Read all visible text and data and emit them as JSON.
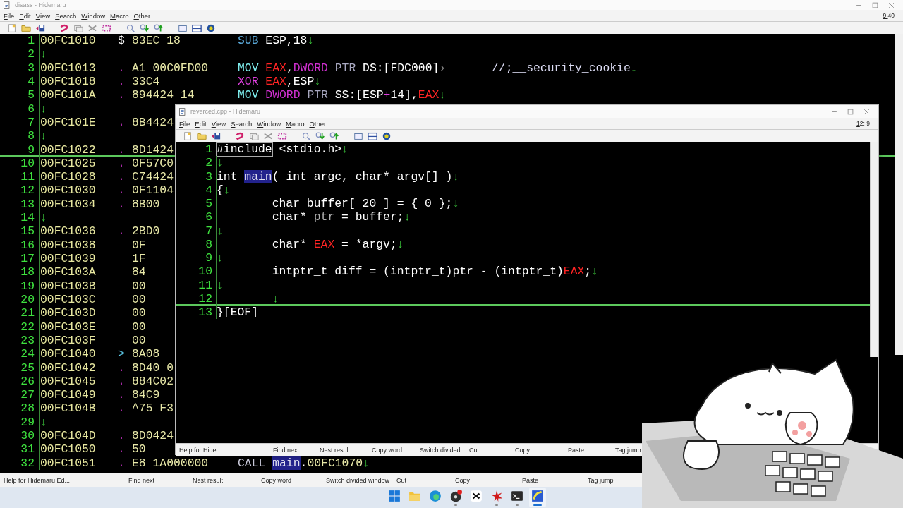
{
  "back_window": {
    "kind": "disassembly",
    "title": "disass - Hidemaru",
    "menu": [
      "File",
      "Edit",
      "View",
      "Search",
      "Window",
      "Macro",
      "Other"
    ],
    "position": "9:40",
    "lines": [
      {
        "number": "1",
        "current": false,
        "address": "00FC1010",
        "marker": {
          "text": "$",
          "kind": "plain"
        },
        "hex": "83EC 18",
        "code": [
          {
            "text": "SUB",
            "kind": "arith"
          },
          {
            "text": " ESP,18",
            "kind": "plain"
          },
          {
            "text": "↓",
            "kind": "eol"
          }
        ]
      },
      {
        "number": "2",
        "current": false,
        "code": [
          {
            "text": "↓",
            "kind": "eol"
          }
        ]
      },
      {
        "number": "3",
        "current": false,
        "address": "00FC1013",
        "marker": {
          "text": ".",
          "kind": "dot"
        },
        "hex": "A1 00C0FD00",
        "code": [
          {
            "text": "MOV ",
            "kind": "move"
          },
          {
            "text": "EAX",
            "kind": "register"
          },
          {
            "text": ",",
            "kind": "plain"
          },
          {
            "text": "DWORD",
            "kind": "size"
          },
          {
            "text": " PTR",
            "kind": "keyword"
          },
          {
            "text": " DS:[FDC000]",
            "kind": "plain"
          },
          {
            "text": "›",
            "kind": "wrap"
          }
        ],
        "comment": [
          {
            "text": "//;__security_cookie",
            "kind": "comment"
          },
          {
            "text": "↓",
            "kind": "eol"
          }
        ]
      },
      {
        "number": "4",
        "current": false,
        "address": "00FC1018",
        "marker": {
          "text": ".",
          "kind": "dot"
        },
        "hex": "33C4",
        "code": [
          {
            "text": "XOR ",
            "kind": "logic"
          },
          {
            "text": "EAX",
            "kind": "register"
          },
          {
            "text": ",ESP",
            "kind": "plain"
          },
          {
            "text": "↓",
            "kind": "eol"
          }
        ]
      },
      {
        "number": "5",
        "current": false,
        "address": "00FC101A",
        "marker": {
          "text": ".",
          "kind": "dot"
        },
        "hex": "894424 14",
        "code": [
          {
            "text": "MOV ",
            "kind": "move"
          },
          {
            "text": "DWORD",
            "kind": "size"
          },
          {
            "text": " PTR",
            "kind": "keyword"
          },
          {
            "text": " SS:[ESP",
            "kind": "plain"
          },
          {
            "text": "+",
            "kind": "operator"
          },
          {
            "text": "14],",
            "kind": "plain"
          },
          {
            "text": "EAX",
            "kind": "register"
          },
          {
            "text": "↓",
            "kind": "eol"
          }
        ]
      },
      {
        "number": "6",
        "current": false,
        "code": [
          {
            "text": "↓",
            "kind": "eol"
          }
        ]
      },
      {
        "number": "7",
        "current": false,
        "address": "00FC101E",
        "marker": {
          "text": ".",
          "kind": "dot"
        },
        "hex": "8B4424"
      },
      {
        "number": "8",
        "current": false,
        "code": [
          {
            "text": "↓",
            "kind": "eol"
          }
        ]
      },
      {
        "number": "9",
        "current": true,
        "address": "00FC1022",
        "marker": {
          "text": ".",
          "kind": "dot"
        },
        "hex": "8D1424"
      },
      {
        "number": "10",
        "current": false,
        "address": "00FC1025",
        "marker": {
          "text": ".",
          "kind": "dot"
        },
        "hex": "0F57C0"
      },
      {
        "number": "11",
        "current": false,
        "address": "00FC1028",
        "marker": {
          "text": ".",
          "kind": "dot"
        },
        "hex": "C74424"
      },
      {
        "number": "12",
        "current": false,
        "address": "00FC1030",
        "marker": {
          "text": ".",
          "kind": "dot"
        },
        "hex": "0F1104"
      },
      {
        "number": "13",
        "current": false,
        "address": "00FC1034",
        "marker": {
          "text": ".",
          "kind": "dot"
        },
        "hex": "8B00"
      },
      {
        "number": "14",
        "current": false,
        "code": [
          {
            "text": "↓",
            "kind": "eol"
          }
        ]
      },
      {
        "number": "15",
        "current": false,
        "address": "00FC1036",
        "marker": {
          "text": ".",
          "kind": "dot"
        },
        "hex": "2BD0"
      },
      {
        "number": "16",
        "current": false,
        "address": "00FC1038",
        "hex": "0F"
      },
      {
        "number": "17",
        "current": false,
        "address": "00FC1039",
        "hex": "1F"
      },
      {
        "number": "18",
        "current": false,
        "address": "00FC103A",
        "hex": "84"
      },
      {
        "number": "19",
        "current": false,
        "address": "00FC103B",
        "hex": "00"
      },
      {
        "number": "20",
        "current": false,
        "address": "00FC103C",
        "hex": "00"
      },
      {
        "number": "21",
        "current": false,
        "address": "00FC103D",
        "hex": "00"
      },
      {
        "number": "22",
        "current": false,
        "address": "00FC103E",
        "hex": "00"
      },
      {
        "number": "23",
        "current": false,
        "address": "00FC103F",
        "hex": "00"
      },
      {
        "number": "24",
        "current": false,
        "address": "00FC1040",
        "marker": {
          "text": ">",
          "kind": "jump"
        },
        "hex": "8A08"
      },
      {
        "number": "25",
        "current": false,
        "address": "00FC1042",
        "marker": {
          "text": ".",
          "kind": "dot"
        },
        "hex": "8D40 0"
      },
      {
        "number": "26",
        "current": false,
        "address": "00FC1045",
        "marker": {
          "text": ".",
          "kind": "dot"
        },
        "hex": "884C02"
      },
      {
        "number": "27",
        "current": false,
        "address": "00FC1049",
        "marker": {
          "text": ".",
          "kind": "dot"
        },
        "hex": "84C9"
      },
      {
        "number": "28",
        "current": false,
        "address": "00FC104B",
        "marker": {
          "text": ".",
          "kind": "dot"
        },
        "hex": "^75 F3"
      },
      {
        "number": "29",
        "current": false,
        "code": [
          {
            "text": "↓",
            "kind": "eol"
          }
        ]
      },
      {
        "number": "30",
        "current": false,
        "address": "00FC104D",
        "marker": {
          "text": ".",
          "kind": "dot"
        },
        "hex": "8D0424"
      },
      {
        "number": "31",
        "current": false,
        "address": "00FC1050",
        "marker": {
          "text": ".",
          "kind": "dot"
        },
        "hex": "50"
      },
      {
        "number": "32",
        "current": false,
        "address": "00FC1051",
        "marker": {
          "text": ".",
          "kind": "dot"
        },
        "hex": "E8 1A000000",
        "code": [
          {
            "text": "CALL ",
            "kind": "call"
          },
          {
            "text": "main",
            "kind": "highlight"
          },
          {
            "text": ".",
            "kind": "plain"
          },
          {
            "text": "00FC1070",
            "kind": "number"
          },
          {
            "text": "↓",
            "kind": "eol"
          }
        ]
      }
    ],
    "function_bar": [
      "Help for Hidemaru Ed...",
      "Find next",
      "Nest result",
      "Copy word",
      "Switch divided window",
      "Cut",
      "Copy",
      "Paste",
      "Tag jump"
    ]
  },
  "front_window": {
    "kind": "source",
    "title": "reverced.cpp - Hidemaru",
    "menu": [
      "File",
      "Edit",
      "View",
      "Search",
      "Window",
      "Macro",
      "Other"
    ],
    "position": "12: 9",
    "lines": [
      {
        "number": "1",
        "current": false,
        "indent": false,
        "code": [
          {
            "text": "#include",
            "kind": "include"
          },
          {
            "text": " <stdio.h>",
            "kind": "plain"
          },
          {
            "text": "↓",
            "kind": "eol"
          }
        ]
      },
      {
        "number": "2",
        "current": false,
        "indent": false,
        "code": [
          {
            "text": "↓",
            "kind": "eol"
          }
        ]
      },
      {
        "number": "3",
        "current": false,
        "indent": false,
        "code": [
          {
            "text": "int ",
            "kind": "plain"
          },
          {
            "text": "main",
            "kind": "highlight"
          },
          {
            "text": "( int argc, char* argv[] )",
            "kind": "plain"
          },
          {
            "text": "↓",
            "kind": "eol"
          }
        ]
      },
      {
        "number": "4",
        "current": false,
        "indent": false,
        "code": [
          {
            "text": "{",
            "kind": "plain"
          },
          {
            "text": "↓",
            "kind": "eol"
          }
        ]
      },
      {
        "number": "5",
        "current": false,
        "indent": true,
        "code": [
          {
            "text": "char buffer[ 20 ] = { 0 };",
            "kind": "plain"
          },
          {
            "text": "↓",
            "kind": "eol"
          }
        ]
      },
      {
        "number": "6",
        "current": false,
        "indent": true,
        "code": [
          {
            "text": "char* ",
            "kind": "plain"
          },
          {
            "text": "ptr",
            "kind": "dim"
          },
          {
            "text": " = buffer;",
            "kind": "plain"
          },
          {
            "text": "↓",
            "kind": "eol"
          }
        ]
      },
      {
        "number": "7",
        "current": false,
        "indent": false,
        "code": [
          {
            "text": "↓",
            "kind": "eol"
          }
        ]
      },
      {
        "number": "8",
        "current": false,
        "indent": true,
        "code": [
          {
            "text": "char* ",
            "kind": "plain"
          },
          {
            "text": "EAX",
            "kind": "register"
          },
          {
            "text": " = *argv;",
            "kind": "plain"
          },
          {
            "text": "↓",
            "kind": "eol"
          }
        ]
      },
      {
        "number": "9",
        "current": false,
        "indent": false,
        "code": [
          {
            "text": "↓",
            "kind": "eol"
          }
        ]
      },
      {
        "number": "10",
        "current": false,
        "indent": true,
        "code": [
          {
            "text": "intptr_t diff = (intptr_t)ptr - (intptr_t)",
            "kind": "plain"
          },
          {
            "text": "EAX",
            "kind": "register"
          },
          {
            "text": ";",
            "kind": "plain"
          },
          {
            "text": "↓",
            "kind": "eol"
          }
        ]
      },
      {
        "number": "11",
        "current": false,
        "indent": false,
        "code": [
          {
            "text": "↓",
            "kind": "eol"
          }
        ]
      },
      {
        "number": "12",
        "current": true,
        "indent": true,
        "code": [
          {
            "text": "↓",
            "kind": "eol"
          }
        ]
      },
      {
        "number": "13",
        "current": false,
        "indent": false,
        "code": [
          {
            "text": "}",
            "kind": "plain"
          },
          {
            "text": "[EOF]",
            "kind": "plain"
          }
        ]
      }
    ],
    "function_bar": [
      "Help for Hide...",
      "Find next",
      "Nest result",
      "Copy word",
      "Switch divided ...",
      "Cut",
      "Copy",
      "Paste",
      "Tag jump"
    ]
  },
  "taskbar": {
    "apps": [
      {
        "kind": "start",
        "selected": false,
        "running": false
      },
      {
        "kind": "folder",
        "selected": false,
        "running": false
      },
      {
        "kind": "browser",
        "selected": false,
        "running": false
      },
      {
        "kind": "recorder",
        "selected": false,
        "running": true
      },
      {
        "kind": "video",
        "selected": false,
        "running": false
      },
      {
        "kind": "splat",
        "selected": false,
        "running": true
      },
      {
        "kind": "terminal",
        "selected": false,
        "running": true
      },
      {
        "kind": "editor",
        "selected": true,
        "running": true
      }
    ]
  }
}
